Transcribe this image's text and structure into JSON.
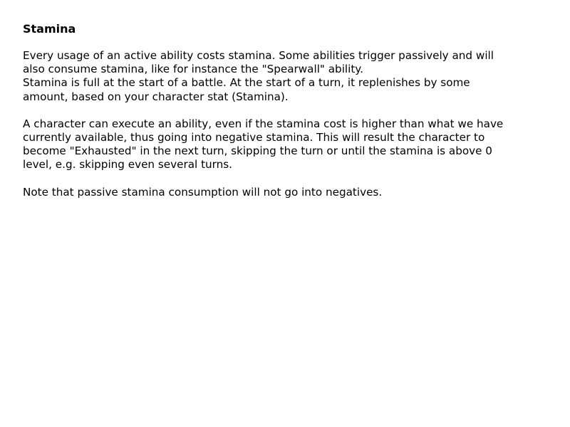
{
  "title": "Stamina",
  "paragraphs": [
    [
      "Every usage of an active ability costs stamina. Some abilities trigger passively and will",
      "also consume stamina, like for instance the \"Spearwall\" ability.",
      "Stamina is full at the start of a battle. At the start of a turn, it replenishes by some",
      "amount, based on your character stat (Stamina)."
    ],
    [
      "A character can execute an ability, even if the stamina cost is higher than what we have",
      "currently available, thus going into negative stamina. This will result the character to",
      "become \"Exhausted\" in the next turn, skipping the turn or until the stamina is above 0",
      "level, e.g. skipping even several turns."
    ],
    [
      "Note that passive stamina consumption will not go into negatives."
    ]
  ]
}
